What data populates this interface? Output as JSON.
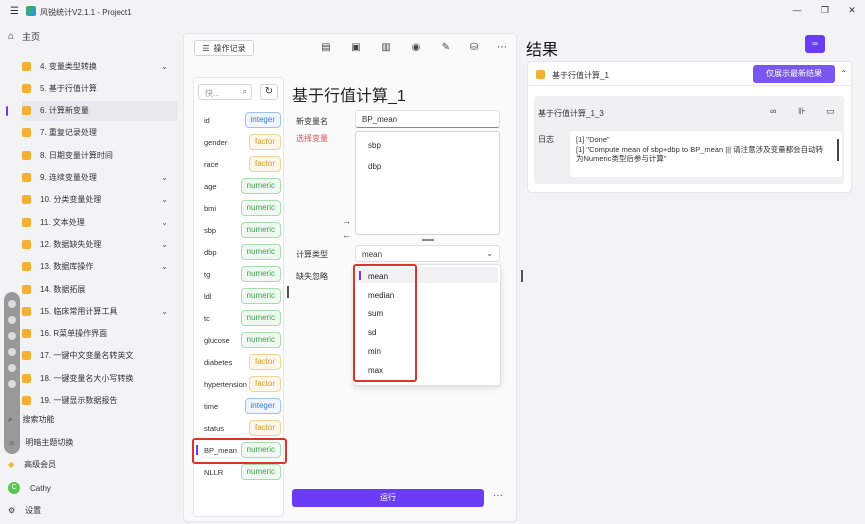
{
  "window": {
    "title": "风锐统计V2.1.1 - Project1"
  },
  "sidebar": {
    "home": "主页",
    "items": [
      {
        "label": "4. 变量类型转换",
        "chevron": true
      },
      {
        "label": "5. 基于行值计算",
        "chevron": false
      },
      {
        "label": "6. 计算新变量",
        "chevron": false,
        "active": true
      },
      {
        "label": "7. 重复记录处理",
        "chevron": false
      },
      {
        "label": "8. 日期变量计算时间",
        "chevron": false
      },
      {
        "label": "9. 连续变量处理",
        "chevron": true
      },
      {
        "label": "10. 分类变量处理",
        "chevron": true
      },
      {
        "label": "11. 文本处理",
        "chevron": true
      },
      {
        "label": "12. 数据缺失处理",
        "chevron": true
      },
      {
        "label": "13. 数据库操作",
        "chevron": true
      },
      {
        "label": "14. 数据拓展",
        "chevron": false
      },
      {
        "label": "15. 临床常用计算工具",
        "chevron": true
      },
      {
        "label": "16. R菜单操作界面",
        "chevron": false
      },
      {
        "label": "17. 一键中文变量名转英文",
        "chevron": false
      },
      {
        "label": "18. 一键变量名大小写转换",
        "chevron": false
      },
      {
        "label": "19. 一键显示数据报告",
        "chevron": false
      }
    ],
    "bottom": {
      "search": "搜索功能",
      "theme": "明暗主题切换",
      "vip": "高级会员",
      "user": "Cathy",
      "user_initial": "C",
      "settings": "设置"
    }
  },
  "middle": {
    "history_button": "操作记录",
    "search_placeholder": "快...",
    "variables": [
      {
        "name": "id",
        "type": "integer"
      },
      {
        "name": "gender",
        "type": "factor"
      },
      {
        "name": "race",
        "type": "factor"
      },
      {
        "name": "age",
        "type": "numeric"
      },
      {
        "name": "bmi",
        "type": "numeric"
      },
      {
        "name": "sbp",
        "type": "numeric"
      },
      {
        "name": "dbp",
        "type": "numeric"
      },
      {
        "name": "tg",
        "type": "numeric"
      },
      {
        "name": "ldl",
        "type": "numeric"
      },
      {
        "name": "tc",
        "type": "numeric"
      },
      {
        "name": "glucose",
        "type": "numeric"
      },
      {
        "name": "diabetes",
        "type": "factor"
      },
      {
        "name": "hypertension",
        "type": "factor"
      },
      {
        "name": "time",
        "type": "integer"
      },
      {
        "name": "status",
        "type": "factor"
      },
      {
        "name": "BP_mean",
        "type": "numeric",
        "selected": true
      },
      {
        "name": "NLLR",
        "type": "numeric"
      }
    ],
    "form": {
      "title": "基于行值计算_1",
      "new_var_label": "新变量名",
      "new_var_value": "BP_mean",
      "select_var_label": "选择变量",
      "selected_vars": [
        "sbp",
        "dbp"
      ],
      "calc_type_label": "计算类型",
      "calc_type_value": "mean",
      "na_label": "缺失忽略",
      "options": [
        "mean",
        "median",
        "sum",
        "sd",
        "min",
        "max"
      ],
      "run_button": "运行",
      "more": "···"
    }
  },
  "results": {
    "title": "结果",
    "card_name": "基于行值计算_1",
    "only_latest": "仅展示最新结果",
    "sub_name": "基于行值计算_1_3",
    "log_label": "日志",
    "log_lines": [
      "[1] \"Done\"",
      "[1] \"Compute mean of sbp+dbp to BP_mean ||| 请注意涉及变量都会自动转",
      "为Numeric类型后参与计算\""
    ]
  },
  "colors": {
    "accent": "#6a3cf5",
    "highlight_red": "#d9362b",
    "db_icon": "#f2b134"
  }
}
